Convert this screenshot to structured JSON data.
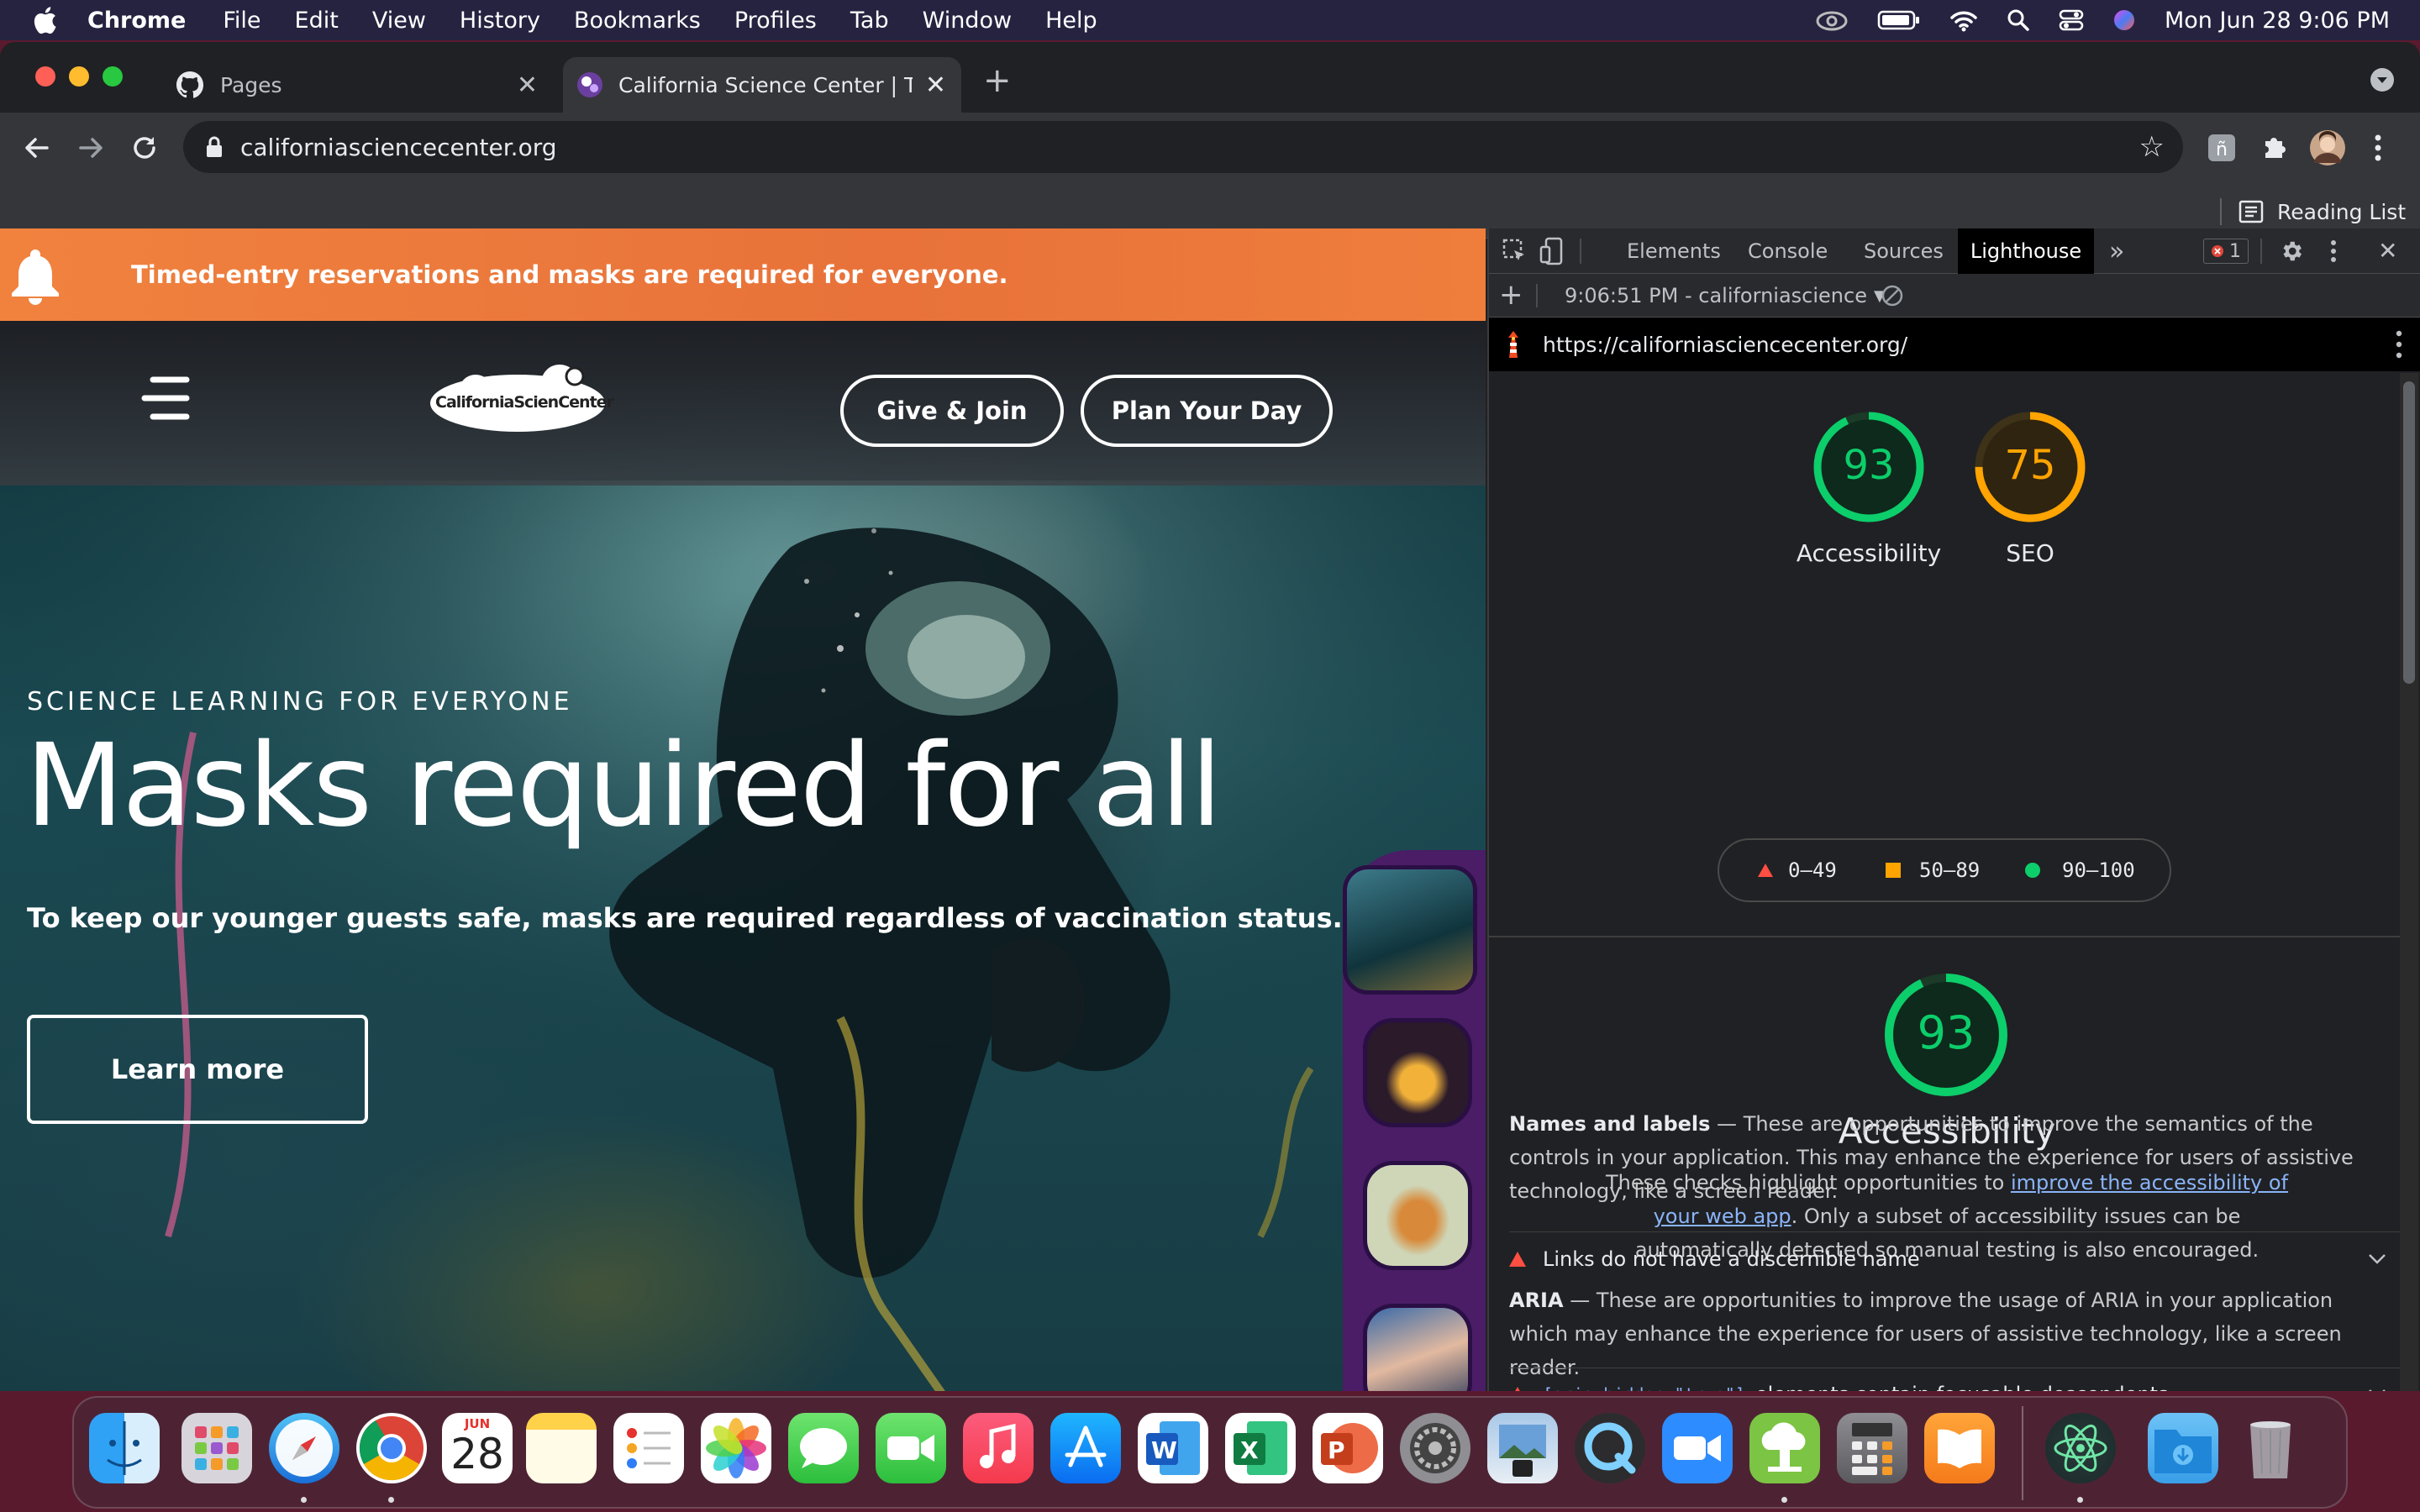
{
  "menubar": {
    "app_name": "Chrome",
    "items": [
      "File",
      "Edit",
      "View",
      "History",
      "Bookmarks",
      "Profiles",
      "Tab",
      "Window",
      "Help"
    ],
    "datetime": "Mon Jun 28  9:06 PM"
  },
  "browser": {
    "tabs": [
      {
        "title": "Pages",
        "icon": "github-icon"
      },
      {
        "title": "California Science Center | The",
        "icon": "science-center-favicon"
      }
    ],
    "url": "californiasciencecenter.org",
    "reading_list": "Reading List"
  },
  "site": {
    "alert": "Timed-entry reservations and masks are required for everyone.",
    "logo_text": "CaliforniaScienCenter",
    "nav_buttons": [
      "Give & Join",
      "Plan Your Day"
    ],
    "eyebrow": "SCIENCE LEARNING FOR EVERYONE",
    "headline": "Masks required for all",
    "subhead": "To keep our younger guests safe, masks are required regardless of vaccination status.",
    "cta": "Learn more"
  },
  "devtools": {
    "tabs": [
      "Elements",
      "Console",
      "Sources",
      "Lighthouse"
    ],
    "active_tab": "Lighthouse",
    "error_count": "1",
    "report_selector": "9:06:51 PM - californiascience",
    "report_url": "https://californiasciencecenter.org/",
    "scores": [
      {
        "label": "Accessibility",
        "value": 93,
        "color": "#0cce6b"
      },
      {
        "label": "SEO",
        "value": 75,
        "color": "#ffa400"
      }
    ],
    "legend": [
      {
        "range": "0–49",
        "color": "#ff4e42"
      },
      {
        "range": "50–89",
        "color": "#ffa400"
      },
      {
        "range": "90–100",
        "color": "#0cce6b"
      }
    ],
    "category": {
      "score": 93,
      "title": "Accessibility",
      "desc_before": "These checks highlight opportunities to ",
      "desc_link": "improve the accessibility of your web app",
      "desc_after": ". Only a subset of accessibility issues can be automatically detected so manual testing is also encouraged."
    },
    "groups": [
      {
        "title": "ARIA",
        "desc": "These are opportunities to improve the usage of ARIA in your application which may enhance the experience for users of assistive technology, like a screen reader.",
        "audit_code": "[aria-hidden=\"true\"]",
        "audit_text": "elements contain focusable descendents"
      },
      {
        "title": "Names and labels",
        "desc": "These are opportunities to improve the semantics of the controls in your application. This may enhance the experience for users of assistive technology, like a screen reader.",
        "audit_text": "Links do not have a discernible name"
      }
    ]
  },
  "dock": {
    "calendar_month": "JUN",
    "calendar_day": "28"
  }
}
